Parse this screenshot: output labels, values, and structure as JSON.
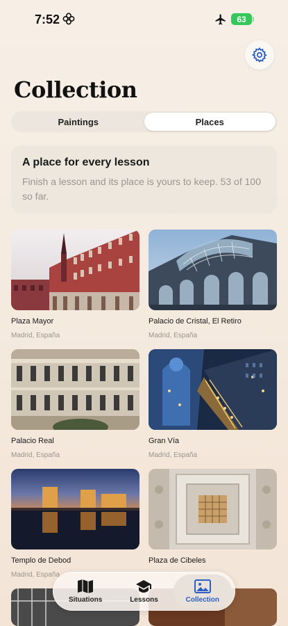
{
  "status": {
    "time": "7:52",
    "battery": "63"
  },
  "header": {
    "title": "Collection"
  },
  "segments": [
    {
      "label": "Paintings",
      "active": false
    },
    {
      "label": "Places",
      "active": true
    }
  ],
  "info": {
    "title": "A place for every lesson",
    "text": "Finish a lesson and its place is yours to keep. 53 of 100 so far."
  },
  "places": [
    {
      "name": "Plaza Mayor",
      "location": "Madrid, España"
    },
    {
      "name": "Palacio de Cristal, El Retiro",
      "location": "Madrid, España"
    },
    {
      "name": "Palacio Real",
      "location": "Madrid, España"
    },
    {
      "name": "Gran Vía",
      "location": "Madrid, España"
    },
    {
      "name": "Templo de Debod",
      "location": "Madrid, España"
    },
    {
      "name": "Plaza de Cibeles",
      "location": ""
    }
  ],
  "tabbar": {
    "items": [
      {
        "label": "Situations",
        "icon": "map-icon"
      },
      {
        "label": "Lessons",
        "icon": "graduation-cap-icon"
      },
      {
        "label": "Collection",
        "icon": "photo-icon",
        "active": true
      }
    ]
  },
  "colors": {
    "accent": "#2d5fc4",
    "battery": "#34c759"
  }
}
